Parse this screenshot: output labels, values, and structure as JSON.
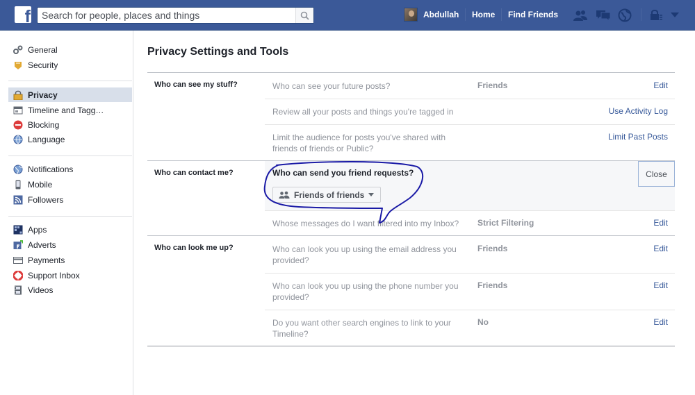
{
  "header": {
    "search_placeholder": "Search for people, places and things",
    "user_name": "Abdullah",
    "home_label": "Home",
    "find_friends_label": "Find Friends",
    "brand_color": "#3b5998"
  },
  "sidebar": {
    "groups": [
      [
        {
          "label": "General",
          "icon": "gear-icon"
        },
        {
          "label": "Security",
          "icon": "badge-icon"
        }
      ],
      [
        {
          "label": "Privacy",
          "icon": "lock-icon",
          "selected": true
        },
        {
          "label": "Timeline and Tagg…",
          "icon": "timeline-icon"
        },
        {
          "label": "Blocking",
          "icon": "block-icon"
        },
        {
          "label": "Language",
          "icon": "globe-icon"
        }
      ],
      [
        {
          "label": "Notifications",
          "icon": "globe-icon"
        },
        {
          "label": "Mobile",
          "icon": "mobile-icon"
        },
        {
          "label": "Followers",
          "icon": "rss-icon"
        }
      ],
      [
        {
          "label": "Apps",
          "icon": "apps-icon"
        },
        {
          "label": "Adverts",
          "icon": "adverts-icon"
        },
        {
          "label": "Payments",
          "icon": "card-icon"
        },
        {
          "label": "Support Inbox",
          "icon": "lifebuoy-icon"
        },
        {
          "label": "Videos",
          "icon": "film-icon"
        }
      ]
    ]
  },
  "main": {
    "title": "Privacy Settings and Tools",
    "sections": [
      {
        "label": "Who can see my stuff?",
        "rows": [
          {
            "question": "Who can see your future posts?",
            "value": "Friends",
            "action": "Edit"
          },
          {
            "question": "Review all your posts and things you're tagged in",
            "value": "",
            "action": "Use Activity Log"
          },
          {
            "question": "Limit the audience for posts you've shared with friends of friends or Public?",
            "value": "",
            "action": "Limit Past Posts"
          }
        ]
      },
      {
        "label": "Who can contact me?",
        "expanded": {
          "question": "Who can send you friend requests?",
          "dropdown_value": "Friends of friends",
          "close_label": "Close"
        },
        "rows": [
          {
            "question": "Whose messages do I want filtered into my Inbox?",
            "value": "Strict Filtering",
            "action": "Edit"
          }
        ]
      },
      {
        "label": "Who can look me up?",
        "rows": [
          {
            "question": "Who can look you up using the email address you provided?",
            "value": "Friends",
            "action": "Edit"
          },
          {
            "question": "Who can look you up using the phone number you provided?",
            "value": "Friends",
            "action": "Edit"
          },
          {
            "question": "Do you want other search engines to link to your Timeline?",
            "value": "No",
            "action": "Edit"
          }
        ]
      }
    ]
  },
  "annotation": {
    "color": "#1a1aa6"
  }
}
